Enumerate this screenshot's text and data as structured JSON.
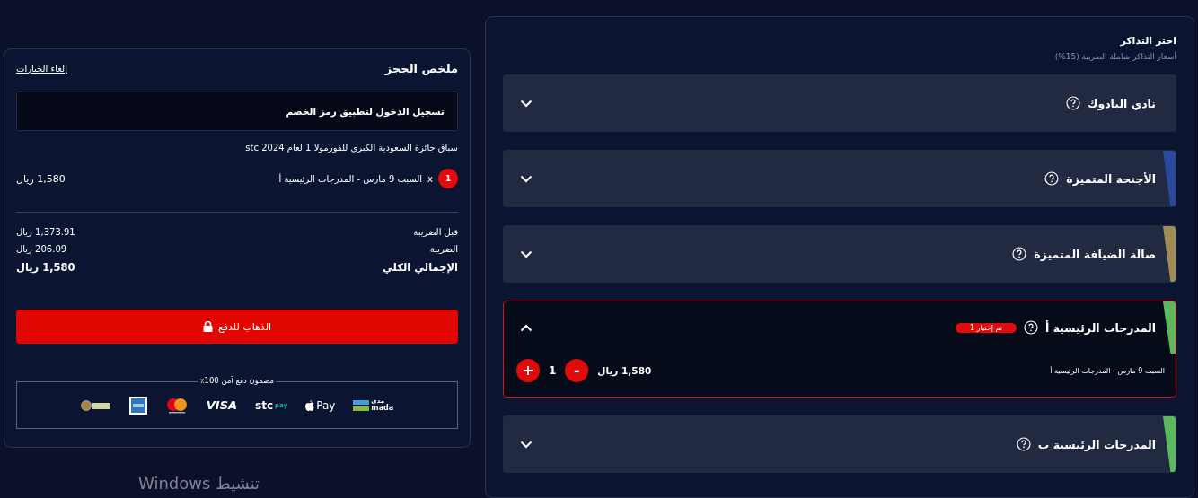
{
  "summary": {
    "title": "ملخص الحجز",
    "cancel_link": "إلغاء الخيارات",
    "login_prompt": "تسجيل الدخول لتطبيق رمز الخصم",
    "event_name": "سباق جائزة السعودية الكبرى للفورمولا 1 لعام stc 2024",
    "line_item": {
      "quantity": "1",
      "times": "x",
      "description": "السبت 9 مارس - المدرجات الرئيسية أ",
      "price": "1,580 ريال"
    },
    "totals": [
      {
        "label": "قبل الضريبة",
        "value": "1,373.91 ريال",
        "kind": "normal"
      },
      {
        "label": "الضريبة",
        "value": "206.09 ريال",
        "kind": "normal"
      },
      {
        "label": "الإجمالي الكلي",
        "value": "1,580 ريال",
        "kind": "grand"
      }
    ],
    "pay_button": "الذهاب للدفع",
    "secure_caption": "مضمون دفع آمن 100٪",
    "payment_methods": [
      {
        "kind": "mada",
        "label": "mada",
        "sub": "مدى"
      },
      {
        "kind": "applepay",
        "label": "Pay"
      },
      {
        "kind": "stcpay",
        "label": "stc",
        "sub": "pay"
      },
      {
        "kind": "visa",
        "label": "VISA"
      },
      {
        "kind": "mastercard"
      },
      {
        "kind": "amex"
      },
      {
        "kind": "seal"
      }
    ]
  },
  "tickets": {
    "title": "اختر التذاكر",
    "subtitle": "أسعار التذاكر شاملة الضريبة (15%)",
    "categories": [
      {
        "name": "نادي البادوك",
        "expanded": false
      },
      {
        "name": "الأجنحة المتميزة",
        "expanded": false,
        "color": "#2c4a9c"
      },
      {
        "name": "صالة الضيافة المتميزة",
        "expanded": false,
        "color": "#a08a55"
      },
      {
        "name": "المدرجات الرئيسية أ",
        "expanded": true,
        "color": "#5cb85c",
        "badge": "تم إختيار 1",
        "option": {
          "description": "السبت 9 مارس - المدرجات الرئيسية أ",
          "price": "1,580 ريال",
          "minus": "-",
          "count": "1",
          "plus": "+"
        }
      },
      {
        "name": "المدرجات الرئيسية ب",
        "expanded": false,
        "color": "#5cb85c"
      }
    ]
  },
  "os_overlay": "تنشيط Windows"
}
